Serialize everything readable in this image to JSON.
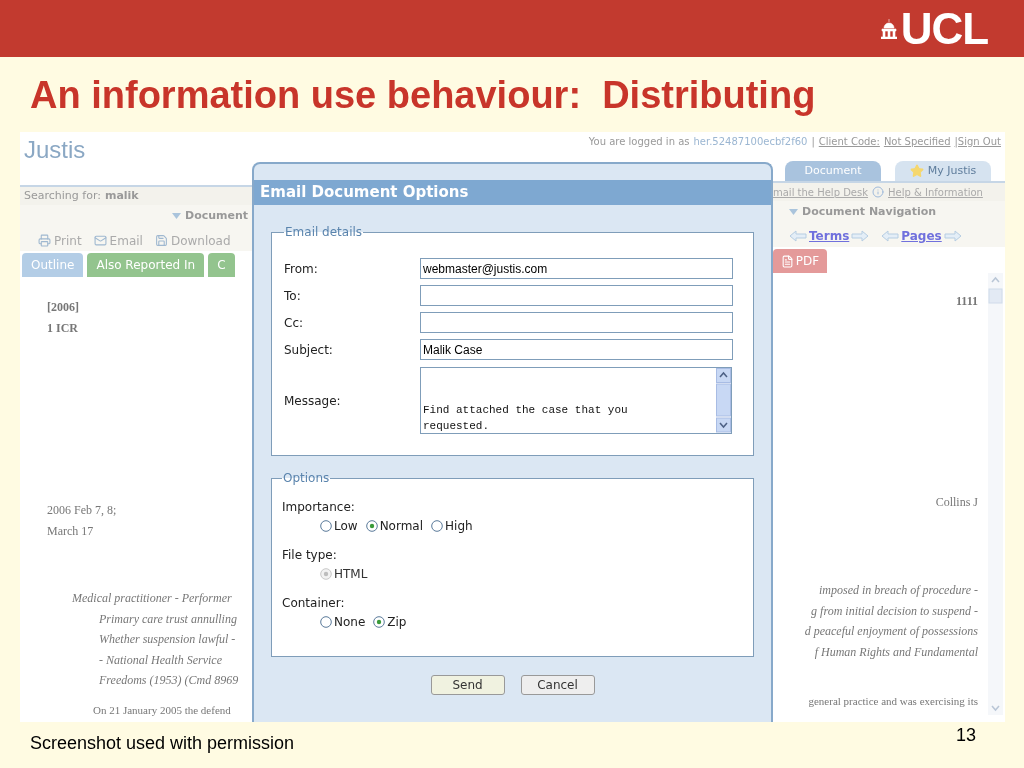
{
  "slide": {
    "logo": "UCL",
    "title": "An information use behaviour:  Distributing",
    "footer": "Screenshot used with permission",
    "page_number": "13"
  },
  "site": {
    "logo": "Justis",
    "login": {
      "prefix": "You are logged in as",
      "user": "her.52487100ecbf2f60",
      "separator": "|",
      "client_code_label": "Client Code:",
      "client_code": "Not Specified",
      "sign_out": "|Sign Out"
    }
  },
  "left": {
    "search": {
      "label": "Searching for:",
      "term": "malik"
    },
    "section": "Document",
    "toolbar": [
      "Print",
      "Email",
      "Download"
    ],
    "tabs": [
      {
        "label": "Outline",
        "color": "#b3cde6"
      },
      {
        "label": "Also Reported In",
        "color": "#93c48e"
      },
      {
        "label": "C",
        "color": "#93c48e"
      }
    ],
    "citation": [
      "[2006]",
      "1 ICR"
    ],
    "date": [
      "2006 Feb 7, 8;",
      "March 17"
    ],
    "catchwords": [
      "Medical practitioner - Performer",
      "Primary care trust annulling",
      "Whether suspension lawful -",
      "- National Health Service",
      "Freedoms (1953) (Cmd 8969"
    ],
    "opening": "On 21 January 2005 the defend"
  },
  "right": {
    "tabs": [
      {
        "label": "Document",
        "selected": true
      },
      {
        "label": "My Justis",
        "selected": false
      }
    ],
    "help": [
      "mail the Help Desk",
      "Help & Information"
    ],
    "navigation": {
      "title": "Document Navigation",
      "links": [
        "Terms",
        "Pages"
      ]
    },
    "pdf": "PDF",
    "page": "1111",
    "judge": "Collins J",
    "catchwords": [
      "imposed in breach of procedure -",
      "g from initial decision to suspend -",
      "d peaceful enjoyment of possessions",
      "f Human Rights and Fundamental"
    ],
    "opening": "general practice and was exercising its"
  },
  "dialog": {
    "title": "Email Document Options",
    "details": {
      "legend": "Email details",
      "fields": [
        {
          "label": "From:",
          "value": "webmaster@justis.com"
        },
        {
          "label": "To:"
        },
        {
          "label": "Cc:"
        },
        {
          "label": "Subject:",
          "value": "Malik Case"
        }
      ],
      "message": {
        "label": "Message:",
        "value": "Find attached the case that you requested."
      }
    },
    "options": {
      "legend": "Options",
      "groups": [
        {
          "label": "Importance:",
          "choices": [
            {
              "label": "Low",
              "selected": false,
              "disabled": false
            },
            {
              "label": "Normal",
              "selected": true,
              "disabled": false
            },
            {
              "label": "High",
              "selected": false,
              "disabled": false
            }
          ]
        },
        {
          "label": "File type:",
          "choices": [
            {
              "label": "HTML",
              "selected": true,
              "disabled": true
            }
          ]
        },
        {
          "label": "Container:",
          "choices": [
            {
              "label": "None",
              "selected": false,
              "disabled": false
            },
            {
              "label": "Zip",
              "selected": true,
              "disabled": false
            }
          ]
        }
      ]
    },
    "buttons": [
      "Send",
      "Cancel"
    ]
  }
}
